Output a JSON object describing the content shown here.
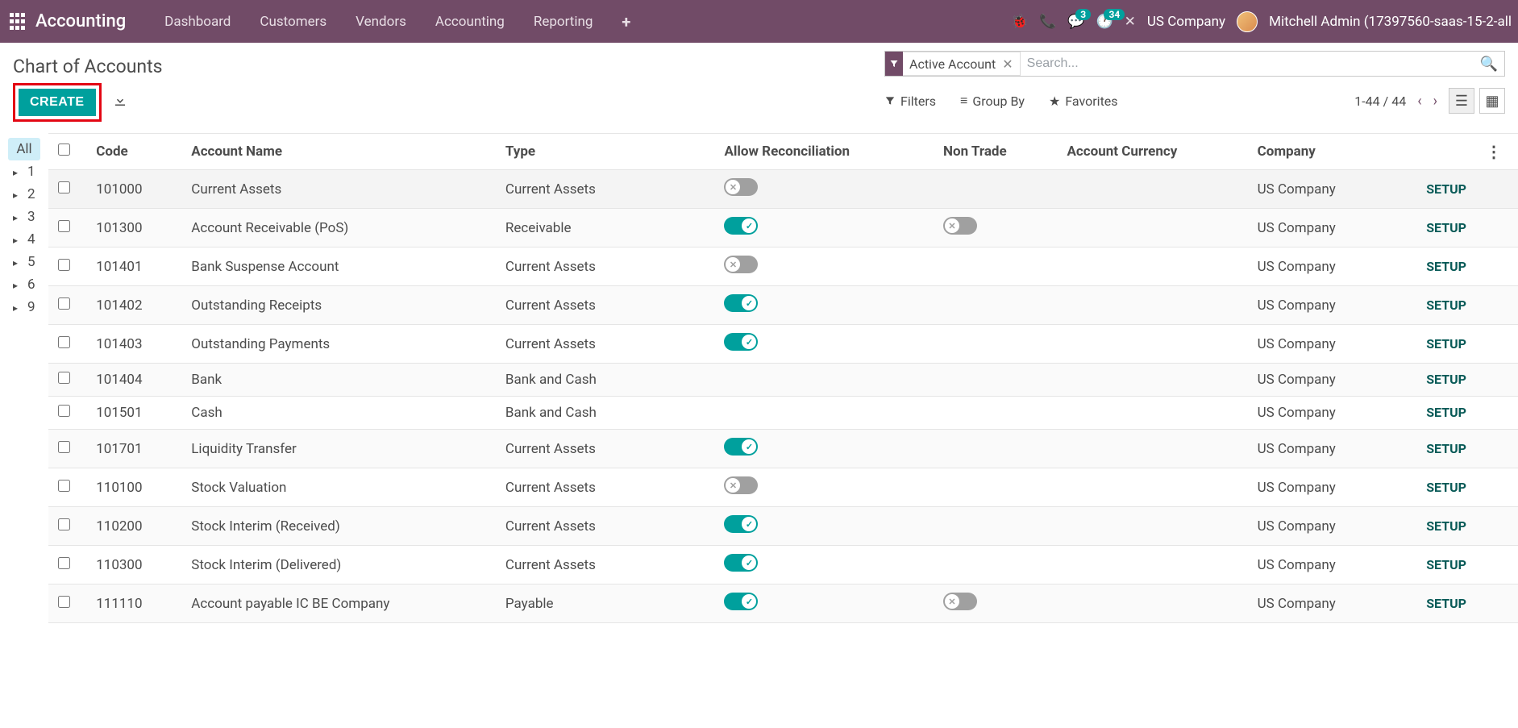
{
  "topbar": {
    "brand": "Accounting",
    "nav": [
      "Dashboard",
      "Customers",
      "Vendors",
      "Accounting",
      "Reporting"
    ],
    "messaging_badge": "3",
    "activity_badge": "34",
    "company": "US Company",
    "user": "Mitchell Admin (17397560-saas-15-2-all"
  },
  "page": {
    "title": "Chart of Accounts",
    "create_label": "CREATE",
    "filter_facet": "Active Account",
    "search_placeholder": "Search...",
    "filters_label": "Filters",
    "groupby_label": "Group By",
    "favorites_label": "Favorites",
    "pager": "1-44 / 44"
  },
  "sidebar": {
    "all": "All",
    "items": [
      "1",
      "2",
      "3",
      "4",
      "5",
      "6",
      "9"
    ]
  },
  "columns": {
    "code": "Code",
    "name": "Account Name",
    "type": "Type",
    "recon": "Allow Reconciliation",
    "nontrade": "Non Trade",
    "currency": "Account Currency",
    "company": "Company"
  },
  "setup_label": "SETUP",
  "rows": [
    {
      "code": "101000",
      "name": "Current Assets",
      "type": "Current Assets",
      "recon": "off",
      "nontrade": "",
      "company": "US Company"
    },
    {
      "code": "101300",
      "name": "Account Receivable (PoS)",
      "type": "Receivable",
      "recon": "on",
      "nontrade": "off",
      "company": "US Company"
    },
    {
      "code": "101401",
      "name": "Bank Suspense Account",
      "type": "Current Assets",
      "recon": "off",
      "nontrade": "",
      "company": "US Company"
    },
    {
      "code": "101402",
      "name": "Outstanding Receipts",
      "type": "Current Assets",
      "recon": "on",
      "nontrade": "",
      "company": "US Company"
    },
    {
      "code": "101403",
      "name": "Outstanding Payments",
      "type": "Current Assets",
      "recon": "on",
      "nontrade": "",
      "company": "US Company"
    },
    {
      "code": "101404",
      "name": "Bank",
      "type": "Bank and Cash",
      "recon": "",
      "nontrade": "",
      "company": "US Company"
    },
    {
      "code": "101501",
      "name": "Cash",
      "type": "Bank and Cash",
      "recon": "",
      "nontrade": "",
      "company": "US Company"
    },
    {
      "code": "101701",
      "name": "Liquidity Transfer",
      "type": "Current Assets",
      "recon": "on",
      "nontrade": "",
      "company": "US Company"
    },
    {
      "code": "110100",
      "name": "Stock Valuation",
      "type": "Current Assets",
      "recon": "off",
      "nontrade": "",
      "company": "US Company"
    },
    {
      "code": "110200",
      "name": "Stock Interim (Received)",
      "type": "Current Assets",
      "recon": "on",
      "nontrade": "",
      "company": "US Company"
    },
    {
      "code": "110300",
      "name": "Stock Interim (Delivered)",
      "type": "Current Assets",
      "recon": "on",
      "nontrade": "",
      "company": "US Company"
    },
    {
      "code": "111110",
      "name": "Account payable IC BE Company",
      "type": "Payable",
      "recon": "on",
      "nontrade": "off",
      "company": "US Company"
    }
  ]
}
